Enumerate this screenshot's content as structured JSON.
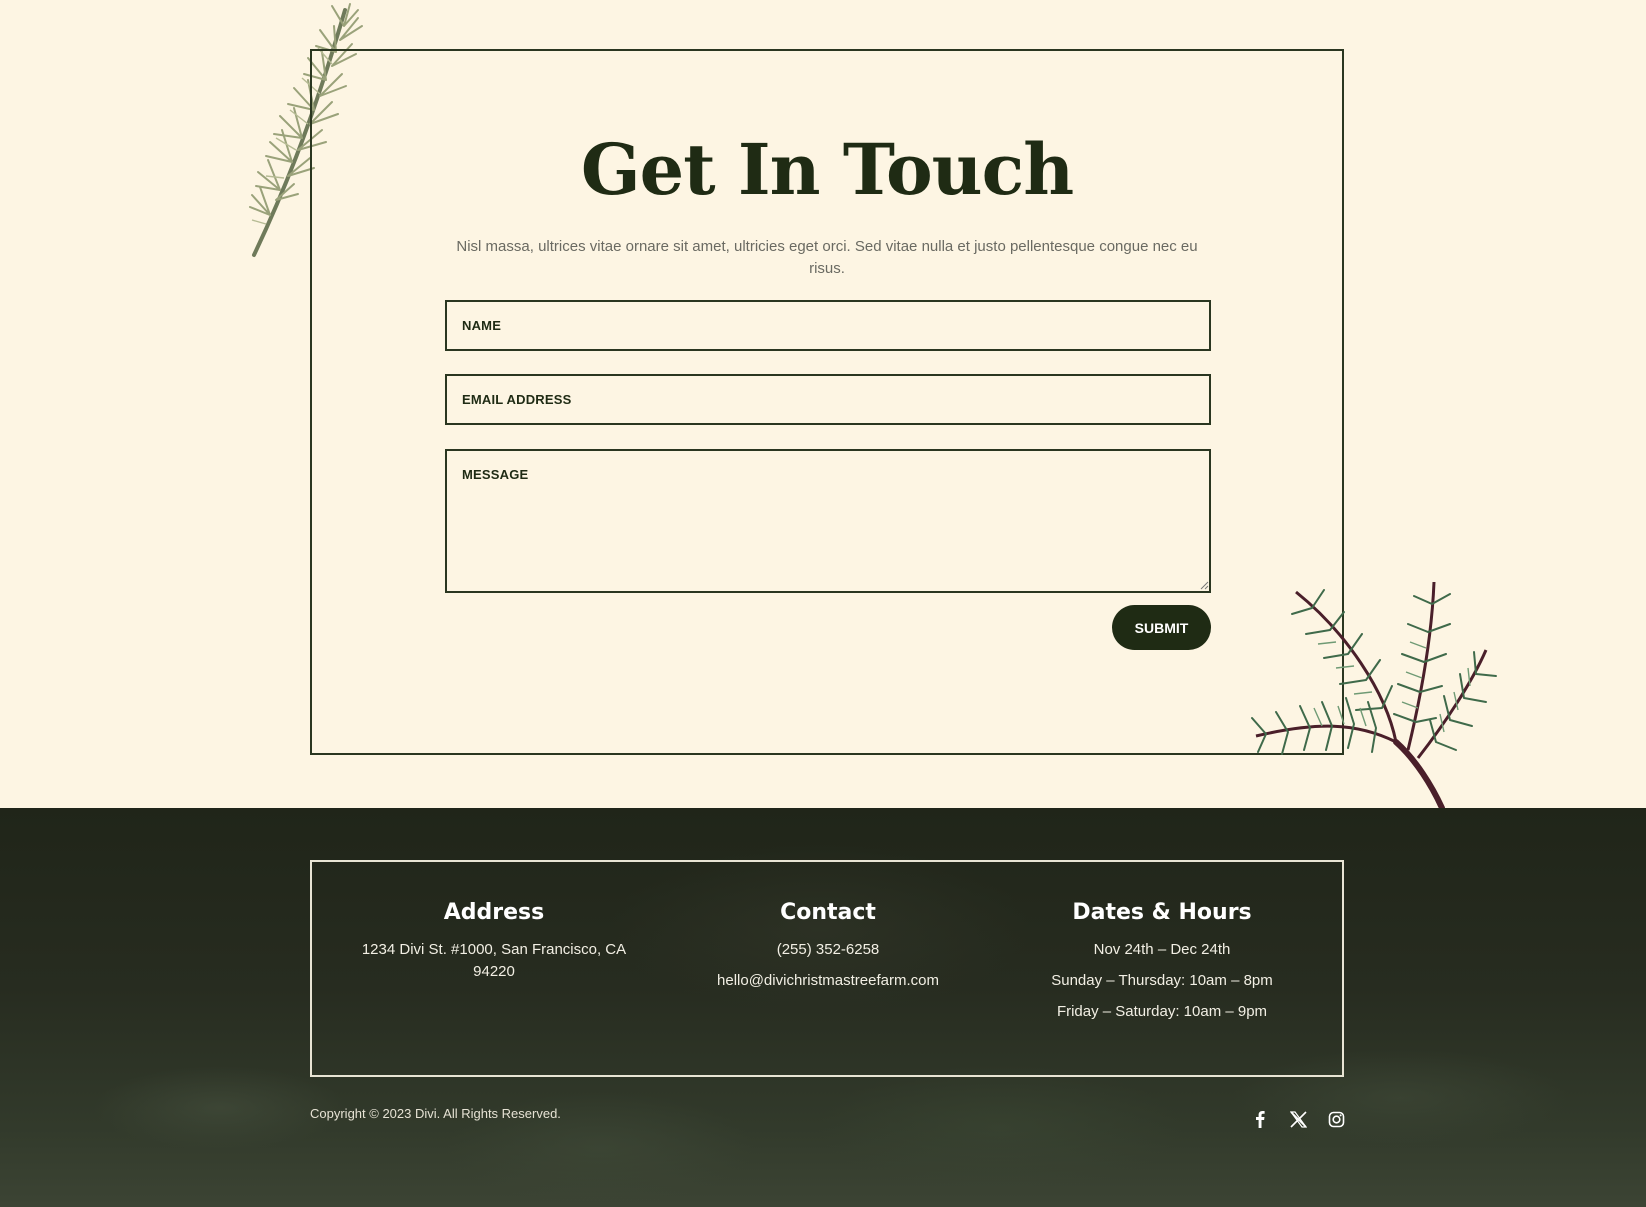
{
  "contact": {
    "title": "Get In Touch",
    "intro": "Nisl massa, ultrices vitae ornare sit amet, ultricies eget orci. Sed vitae nulla et justo pellentesque congue nec eu risus.",
    "name_placeholder": "NAME",
    "email_placeholder": "EMAIL ADDRESS",
    "message_placeholder": "MESSAGE",
    "submit_label": "SUBMIT"
  },
  "footer": {
    "address": {
      "heading": "Address",
      "lines": [
        "1234 Divi St. #1000, San Francisco, CA 94220"
      ]
    },
    "contact": {
      "heading": "Contact",
      "phone": "(255) 352-6258",
      "email": "hello@divichristmastreefarm.com"
    },
    "hours": {
      "heading": "Dates & Hours",
      "lines": [
        "Nov 24th – Dec 24th",
        "Sunday – Thursday: 10am – 8pm",
        "Friday – Saturday: 10am – 9pm"
      ]
    },
    "copyright": "Copyright © 2023 Divi. All Rights Reserved.",
    "social": [
      "facebook-icon",
      "x-icon",
      "instagram-icon"
    ]
  },
  "colors": {
    "background": "#fdf5e3",
    "dark_green": "#1f2b14",
    "footer_bg": "#232820"
  }
}
